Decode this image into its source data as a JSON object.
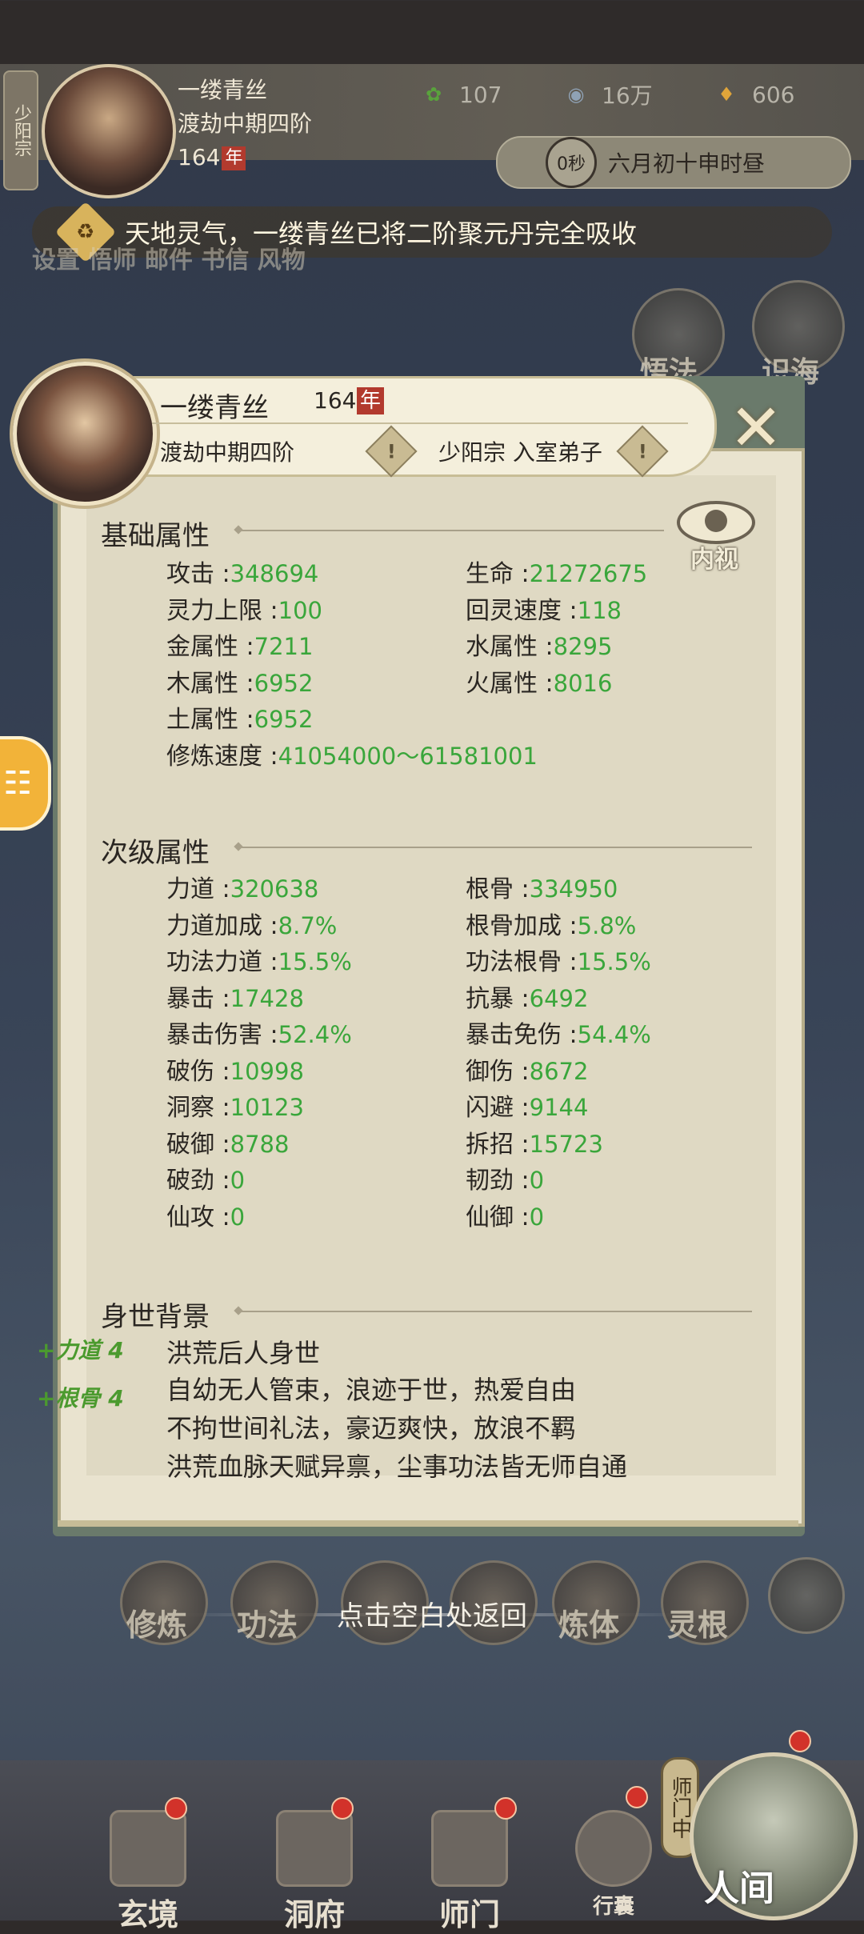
{
  "top": {
    "sect_tag": "少阳宗",
    "name": "一缕青丝",
    "realm": "渡劫中期四阶",
    "age": "164",
    "age_unit": "年",
    "resources": [
      {
        "icon": "spirit-leaf-icon",
        "value": "107",
        "color": "#59a33c"
      },
      {
        "icon": "spirit-stone-icon",
        "value": "16万",
        "color": "#8fa2b5"
      },
      {
        "icon": "gold-ingot-icon",
        "value": "606",
        "color": "#e0a53a"
      }
    ],
    "timer": "0秒",
    "date": "六月初十申时昼"
  },
  "notice": "天地灵气，一缕青丝已将二阶聚元丹完全吸收",
  "background_labels": {
    "top_row": "设置 悟师 邮件 书信 风物",
    "wufa": "悟法",
    "shihai": "识海"
  },
  "header": {
    "name": "一缕青丝",
    "age": "164",
    "age_unit": "年",
    "realm": "渡劫中期四阶",
    "sect": "少阳宗 入室弟子",
    "warn_symbol": "!"
  },
  "eye_label": "内视",
  "basic": {
    "title": "基础属性",
    "rows": [
      {
        "l": "攻击",
        "lv": "348694",
        "r": "生命",
        "rv": "21272675"
      },
      {
        "l": "灵力上限",
        "lv": "100",
        "r": "回灵速度",
        "rv": "118"
      },
      {
        "l": "金属性",
        "lv": "7211",
        "r": "水属性",
        "rv": "8295"
      },
      {
        "l": "木属性",
        "lv": "6952",
        "r": "火属性",
        "rv": "8016"
      },
      {
        "l": "土属性",
        "lv": "6952",
        "r": "",
        "rv": ""
      },
      {
        "l": "修炼速度",
        "lv": "41054000～61581001",
        "r": "",
        "rv": ""
      }
    ]
  },
  "secondary": {
    "title": "次级属性",
    "rows": [
      {
        "l": "力道",
        "lv": "320638",
        "r": "根骨",
        "rv": "334950"
      },
      {
        "l": "力道加成",
        "lv": "8.7%",
        "r": "根骨加成",
        "rv": "5.8%"
      },
      {
        "l": "功法力道",
        "lv": "15.5%",
        "r": "功法根骨",
        "rv": "15.5%"
      },
      {
        "l": "暴击",
        "lv": "17428",
        "r": "抗暴",
        "rv": "6492"
      },
      {
        "l": "暴击伤害",
        "lv": "52.4%",
        "r": "暴击免伤",
        "rv": "54.4%"
      },
      {
        "l": "破伤",
        "lv": "10998",
        "r": "御伤",
        "rv": "8672"
      },
      {
        "l": "洞察",
        "lv": "10123",
        "r": "闪避",
        "rv": "9144"
      },
      {
        "l": "破御",
        "lv": "8788",
        "r": "拆招",
        "rv": "15723"
      },
      {
        "l": "破劲",
        "lv": "0",
        "r": "韧劲",
        "rv": "0"
      },
      {
        "l": "仙攻",
        "lv": "0",
        "r": "仙御",
        "rv": "0"
      }
    ]
  },
  "background": {
    "title": "身世背景",
    "bonuses": [
      "+力道 4",
      "+根骨 4"
    ],
    "lines": [
      "洪荒后人身世",
      "自幼无人管束，浪迹于世，热爱自由",
      "不拘世间礼法，豪迈爽快，放浪不羁",
      "洪荒血脉天赋异禀，尘事功法皆无师自通"
    ]
  },
  "return_hint": "点击空白处返回",
  "skills": [
    "修炼",
    "功法",
    "",
    "",
    "炼体",
    "灵根"
  ],
  "nav": [
    "玄境",
    "洞府",
    "师门",
    "行囊",
    "人间"
  ],
  "shimen_tag": "师门中"
}
